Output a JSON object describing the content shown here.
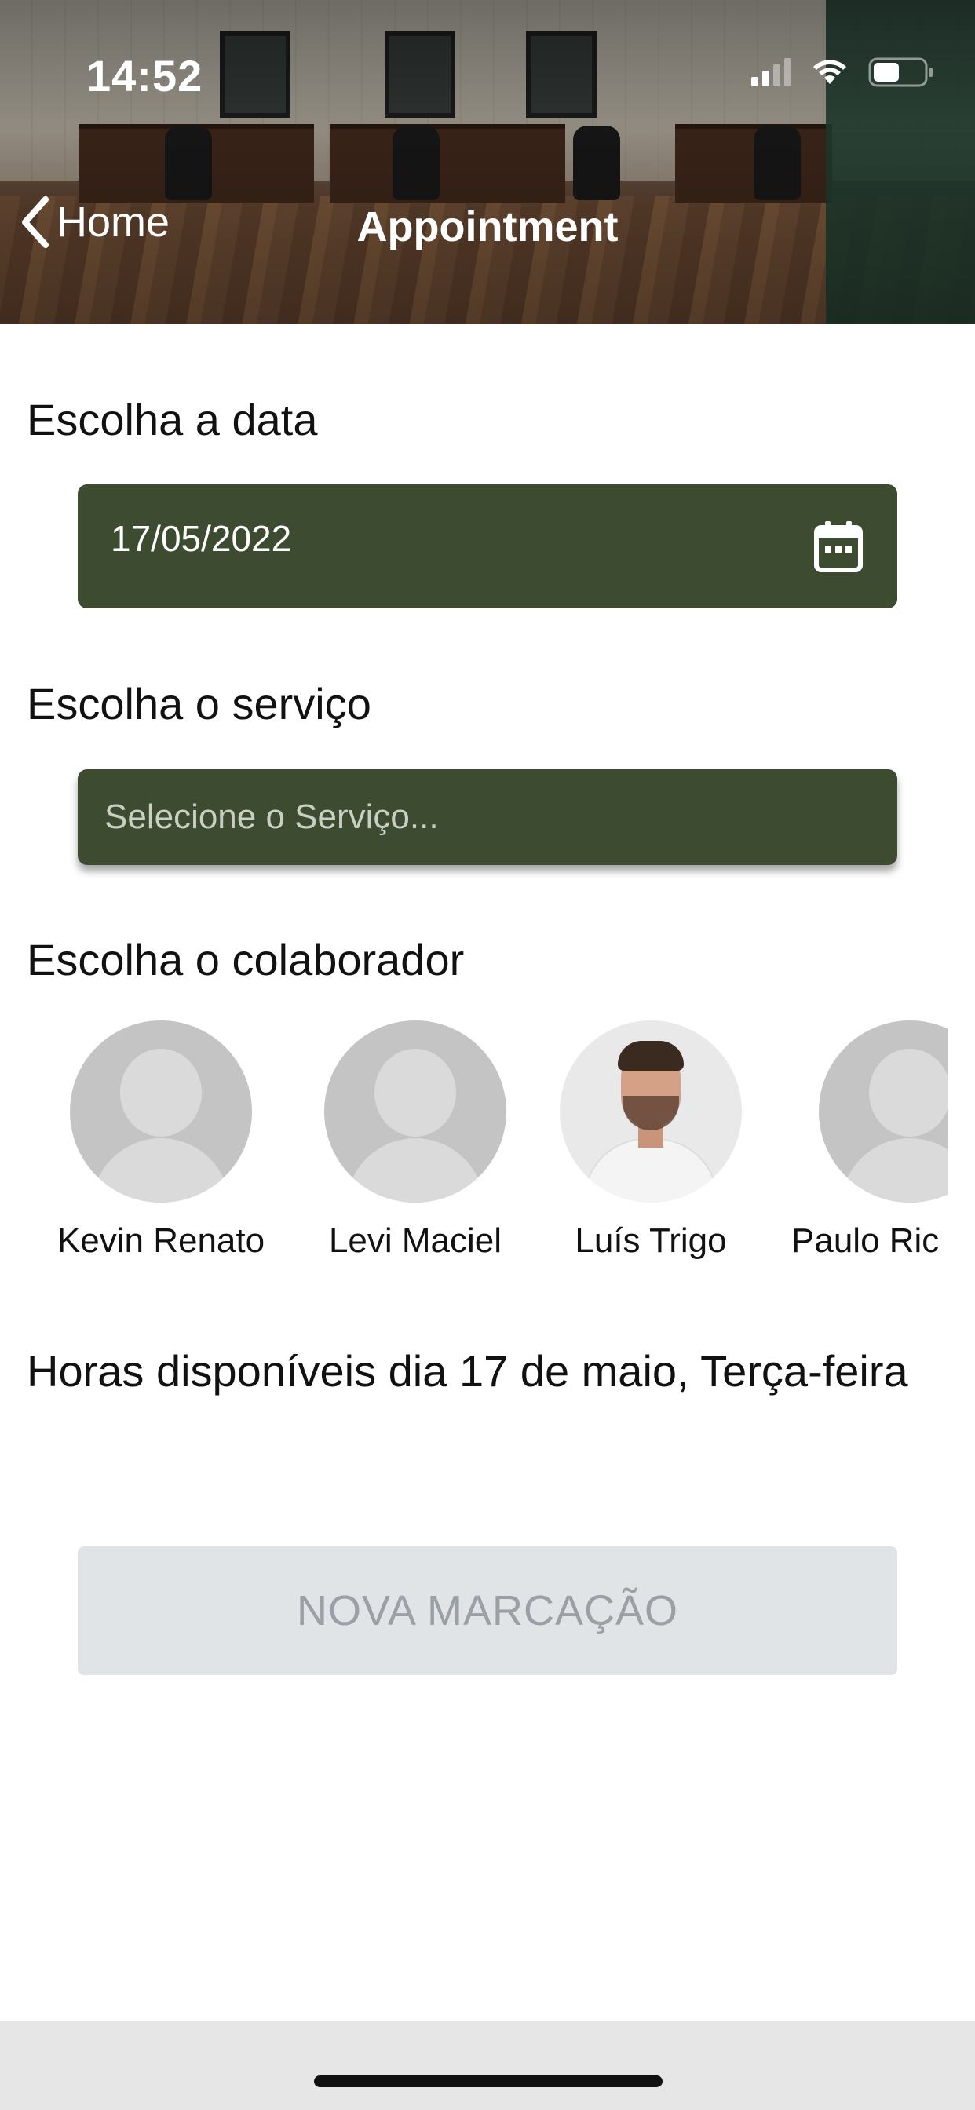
{
  "status_bar": {
    "time": "14:52"
  },
  "nav": {
    "back_label": "Home",
    "title": "Appointment"
  },
  "date_section": {
    "label": "Escolha a data",
    "value": "17/05/2022"
  },
  "service_section": {
    "label": "Escolha o serviço",
    "placeholder": "Selecione o Serviço..."
  },
  "collaborator_section": {
    "label": "Escolha o colaborador",
    "collaborators": [
      {
        "name": "Kevin Renato",
        "has_photo": false
      },
      {
        "name": "Levi Maciel",
        "has_photo": false
      },
      {
        "name": "Luís Trigo",
        "has_photo": true
      },
      {
        "name": "Paulo Ric",
        "has_photo": false
      }
    ]
  },
  "hours_section": {
    "title": "Horas disponíveis dia 17 de maio, Terça-feira"
  },
  "new_appointment_button": {
    "label": "NOVA MARCAÇÃO"
  },
  "colors": {
    "accent": "#3d4c30",
    "button_disabled_bg": "#e1e4e7",
    "button_disabled_text": "#9aa0a6"
  }
}
